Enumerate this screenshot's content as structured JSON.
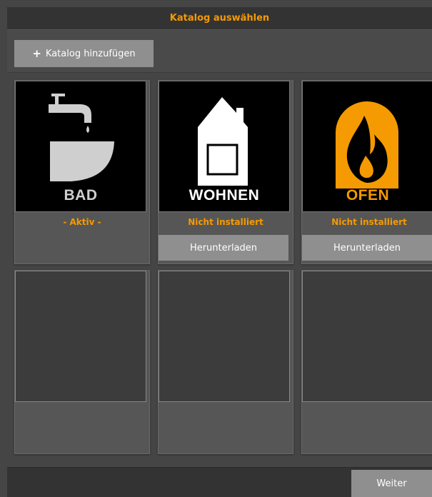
{
  "window": {
    "title": "Katalog auswählen"
  },
  "toolbar": {
    "add_icon": "+",
    "add_label": "Katalog hinzufügen"
  },
  "catalogs": [
    {
      "name": "BAD",
      "icon": "faucet-sink-icon",
      "caption_color": "#cfcfcf",
      "status": "- Aktiv -"
    },
    {
      "name": "WOHNEN",
      "icon": "house-icon",
      "caption_color": "#ffffff",
      "status": "Nicht installiert",
      "action": "Herunterladen"
    },
    {
      "name": "OFEN",
      "icon": "flame-oven-icon",
      "caption_color": "#f59a00",
      "status": "Nicht installiert",
      "action": "Herunterladen"
    }
  ],
  "footer": {
    "next_label": "Weiter"
  },
  "colors": {
    "accent": "#f59a00",
    "button": "#8f8f8f",
    "background": "#454545"
  }
}
